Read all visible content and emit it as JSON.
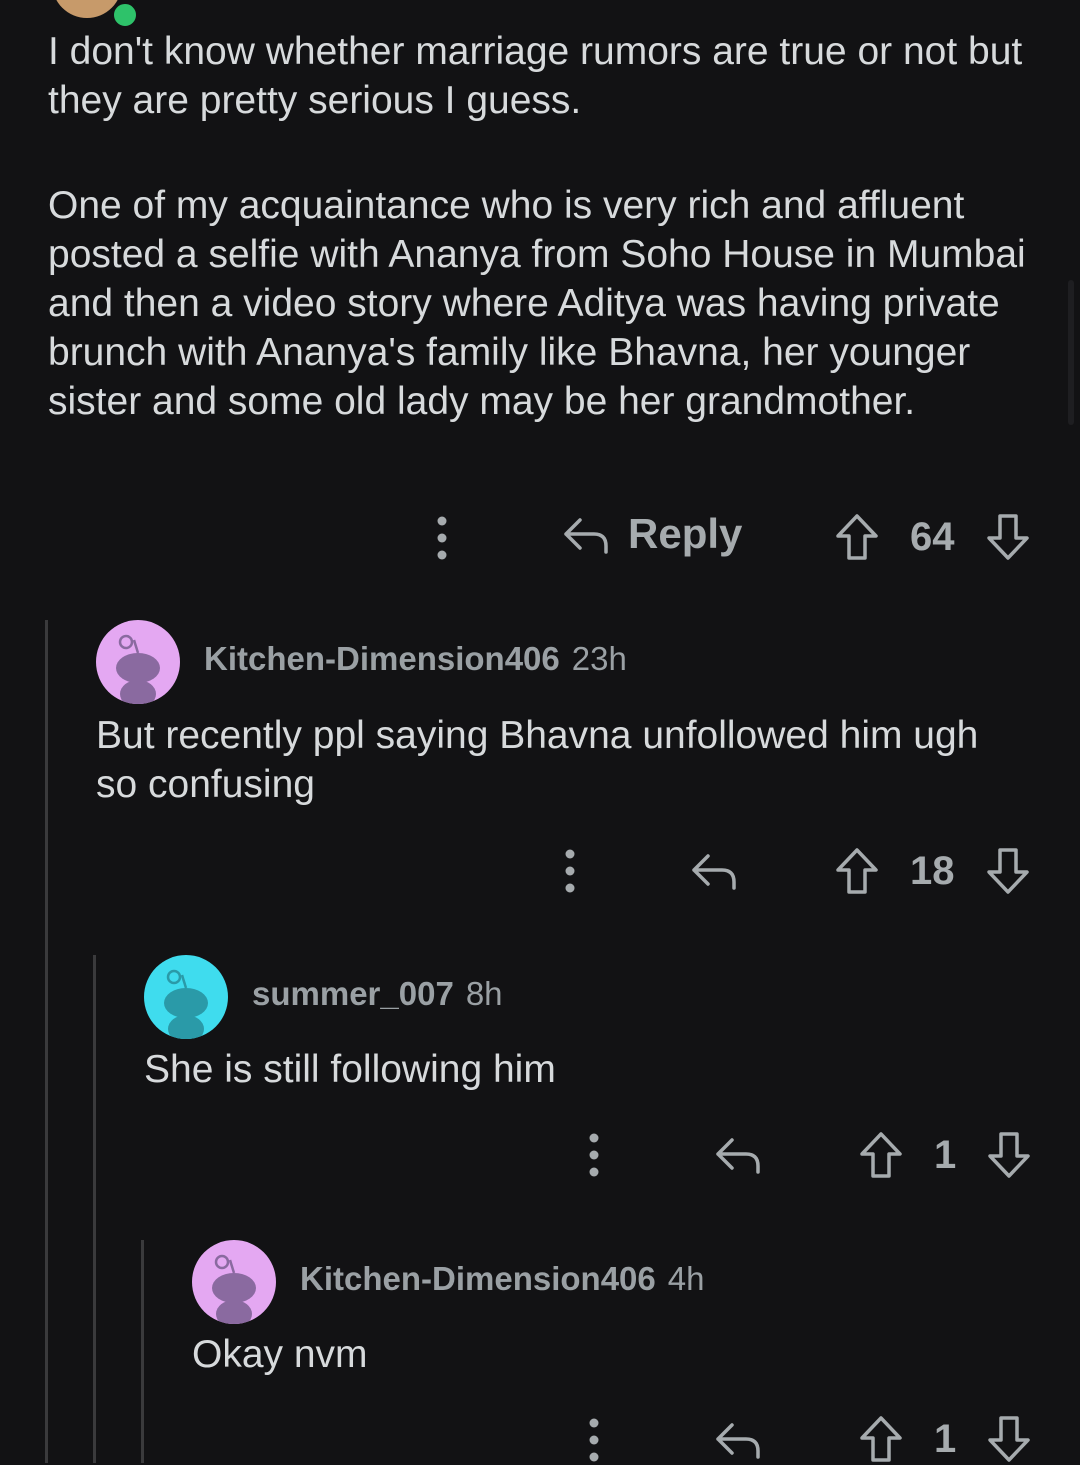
{
  "top_comment": {
    "paragraph1": "I don't know whether marriage rumors are true or not but they are pretty serious I guess.",
    "paragraph2": "One of my acquaintance who is very rich and affluent posted a selfie with Ananya from Soho House in Mumbai and then a video story where Aditya was having private brunch with Ananya's family like Bhavna, her younger sister and some old lady may be her grandmother.",
    "reply_label": "Reply",
    "votes": "64"
  },
  "replies": [
    {
      "username": "Kitchen-Dimension406",
      "time": "23h",
      "body": "But recently ppl saying Bhavna unfollowed him ugh so confusing",
      "votes": "18",
      "avatar_color": "#e4a8f2"
    },
    {
      "username": "summer_007",
      "time": "8h",
      "body": "She is still following him",
      "votes": "1",
      "avatar_color": "#3fdcee"
    },
    {
      "username": "Kitchen-Dimension406",
      "time": "4h",
      "body": "Okay nvm",
      "votes": "1",
      "avatar_color": "#e4a8f2"
    }
  ],
  "icons": {
    "more": "more-options-icon",
    "reply": "reply-arrow-icon",
    "upvote": "upvote-arrow-icon",
    "downvote": "downvote-arrow-icon",
    "online": "online-status-dot"
  },
  "colors": {
    "background": "#121214",
    "text": "#d7dadc",
    "meta": "#9aa0a4",
    "online": "#2ec26a"
  }
}
